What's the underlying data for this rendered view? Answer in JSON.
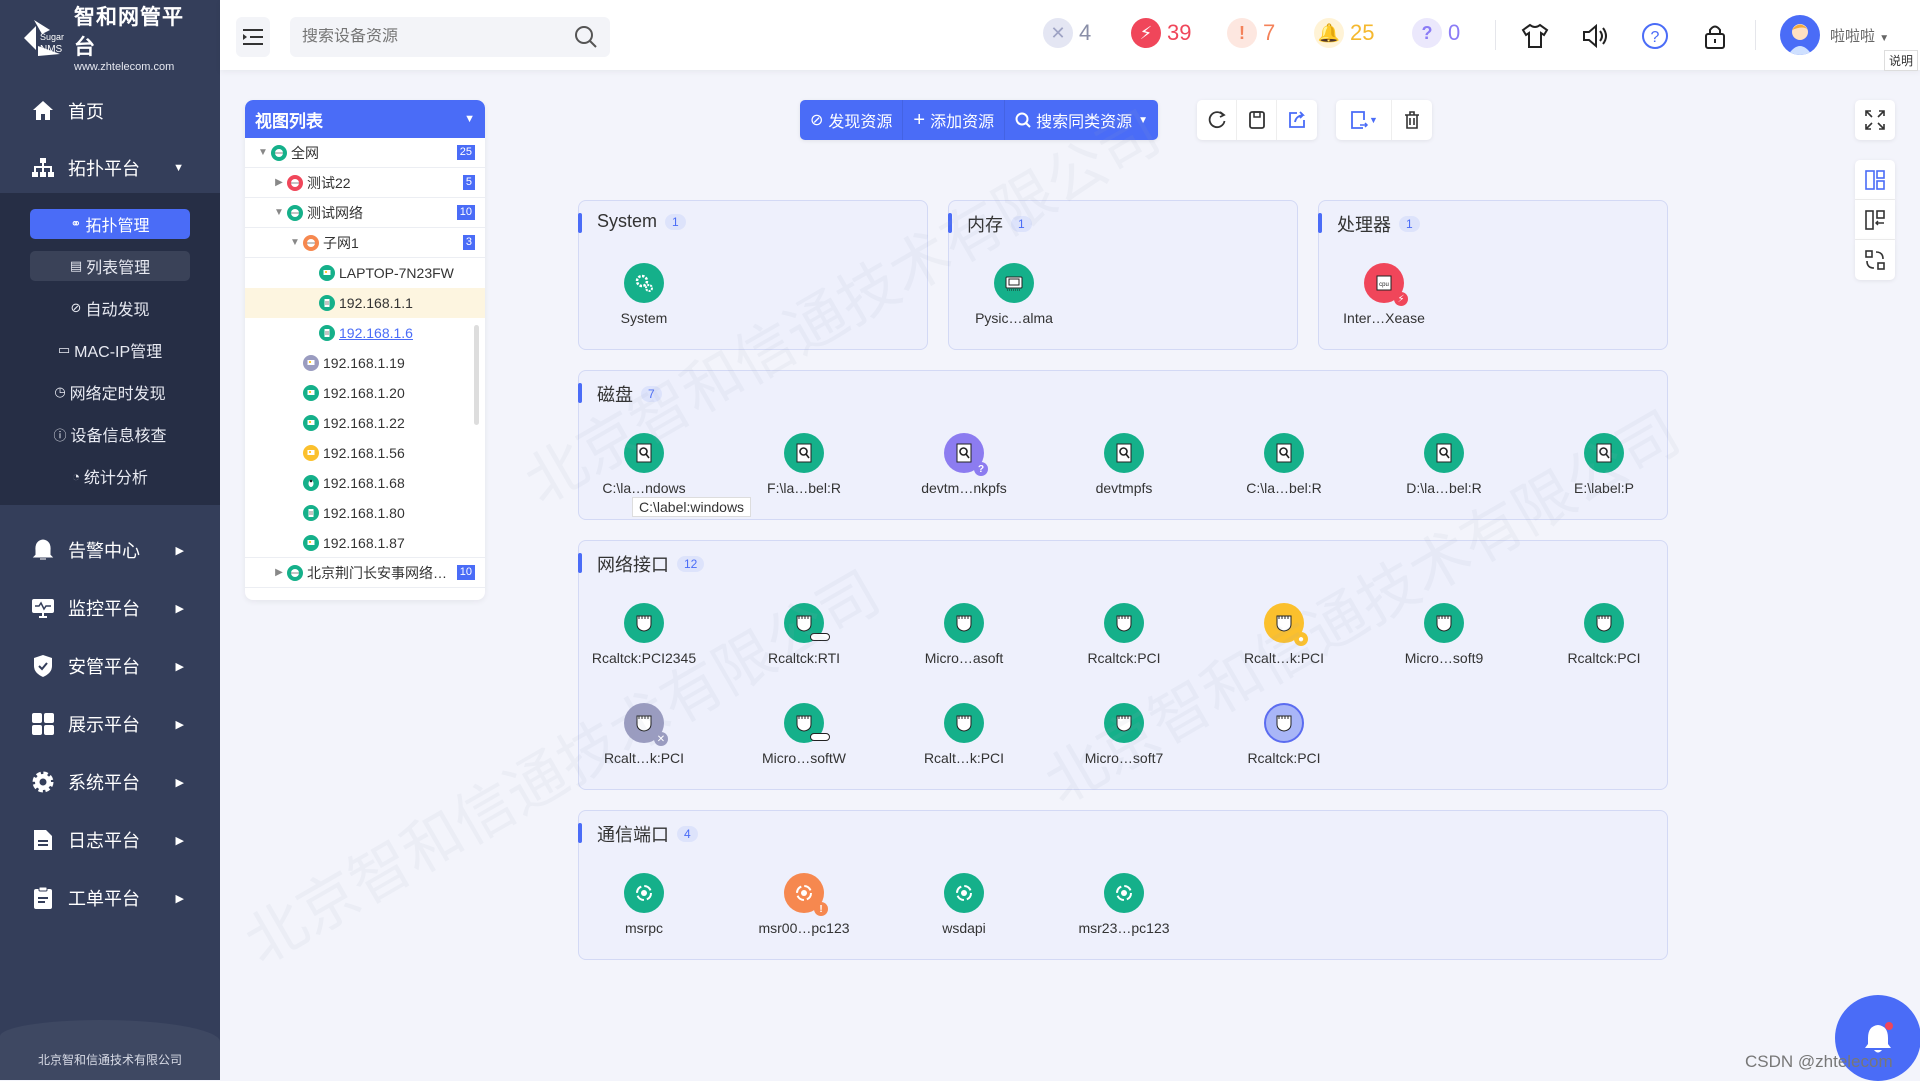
{
  "brand": {
    "title": "智和网管平台",
    "sub": "www.zhtelecom.com",
    "mark": "Sugar NMS"
  },
  "sidebar": {
    "items": [
      {
        "label": "首页",
        "icon": "home-icon"
      },
      {
        "label": "拓扑平台",
        "icon": "topology-icon",
        "expanded": true
      },
      {
        "label": "告警中心",
        "icon": "bell-icon"
      },
      {
        "label": "监控平台",
        "icon": "monitor-icon"
      },
      {
        "label": "安管平台",
        "icon": "shield-icon"
      },
      {
        "label": "展示平台",
        "icon": "grid-icon"
      },
      {
        "label": "系统平台",
        "icon": "gear-icon"
      },
      {
        "label": "日志平台",
        "icon": "log-icon"
      },
      {
        "label": "工单平台",
        "icon": "clipboard-icon"
      }
    ],
    "subitems": [
      {
        "label": "拓扑管理",
        "glyph": "⚭",
        "active": true
      },
      {
        "label": "列表管理",
        "glyph": "▤"
      },
      {
        "label": "自动发现",
        "glyph": "⊘"
      },
      {
        "label": "MAC-IP管理",
        "glyph": "▭"
      },
      {
        "label": "网络定时发现",
        "glyph": "◷"
      },
      {
        "label": "设备信息核查",
        "glyph": "ⓘ"
      },
      {
        "label": "统计分析",
        "glyph": "◔"
      }
    ],
    "footer": "北京智和信通技术有限公司"
  },
  "header": {
    "search_placeholder": "搜索设备资源",
    "stats": [
      {
        "name": "unknown",
        "glyph": "✕",
        "count": "4",
        "bg": "#e4e6f3",
        "fg": "#9ea3c4",
        "text": "#8a8fa8"
      },
      {
        "name": "critical",
        "glyph": "⚡",
        "count": "39",
        "bg": "#f0465a",
        "fg": "#ffffff",
        "text": "#f0465a"
      },
      {
        "name": "major",
        "glyph": "!",
        "count": "7",
        "bg": "#fde7e0",
        "fg": "#f4825a",
        "text": "#f4825a"
      },
      {
        "name": "warning",
        "glyph": "🔔",
        "count": "25",
        "bg": "#fff3d6",
        "fg": "#fbb827",
        "text": "#f5b82e"
      },
      {
        "name": "question",
        "glyph": "?",
        "count": "0",
        "bg": "#ebe8fc",
        "fg": "#8b7cf6",
        "text": "#8b7cf6"
      }
    ],
    "help_tooltip": "说明",
    "username": "啦啦啦"
  },
  "tree": {
    "title": "视图列表",
    "rows": [
      {
        "label": "全网",
        "level": 0,
        "arrow": "down",
        "icon": "globe",
        "color": "#15b08a",
        "badge": "25",
        "border": true
      },
      {
        "label": "测试22",
        "level": 1,
        "arrow": "right",
        "icon": "globe",
        "color": "#f0465a",
        "badge": "5",
        "border": true
      },
      {
        "label": "测试网络",
        "level": 1,
        "arrow": "down",
        "icon": "globe",
        "color": "#15b08a",
        "badge": "10",
        "border": true
      },
      {
        "label": "子网1",
        "level": 2,
        "arrow": "down",
        "icon": "globe",
        "color": "#f6884f",
        "badge": "3",
        "border": true
      },
      {
        "label": "LAPTOP-7N23FW",
        "level": 3,
        "icon": "monitor",
        "color": "#15b08a"
      },
      {
        "label": "192.168.1.1",
        "level": 3,
        "icon": "server",
        "color": "#15b08a",
        "highlight": true
      },
      {
        "label": "192.168.1.6",
        "level": 3,
        "icon": "server",
        "color": "#15b08a",
        "link": true
      },
      {
        "label": "192.168.1.19",
        "level": 2,
        "icon": "monitor",
        "color": "#9a9cc0"
      },
      {
        "label": "192.168.1.20",
        "level": 2,
        "icon": "monitor",
        "color": "#15b08a"
      },
      {
        "label": "192.168.1.22",
        "level": 2,
        "icon": "monitor",
        "color": "#15b08a"
      },
      {
        "label": "192.168.1.56",
        "level": 2,
        "icon": "monitor",
        "color": "#fbc02d"
      },
      {
        "label": "192.168.1.68",
        "level": 2,
        "icon": "linux",
        "color": "#15b08a"
      },
      {
        "label": "192.168.1.80",
        "level": 2,
        "icon": "server",
        "color": "#15b08a"
      },
      {
        "label": "192.168.1.87",
        "level": 2,
        "icon": "monitor",
        "color": "#15b08a",
        "border": true
      },
      {
        "label": "北京荆门长安事网络…",
        "level": 1,
        "arrow": "right",
        "icon": "globe",
        "color": "#15b08a",
        "badge": "10",
        "border": true
      }
    ]
  },
  "toolbar": {
    "discover": "发现资源",
    "add": "添加资源",
    "search_similar": "搜索同类资源"
  },
  "groups": [
    {
      "title": "System",
      "count": "1",
      "kind": "system",
      "items": [
        {
          "label": "System",
          "status": "ok"
        }
      ]
    },
    {
      "title": "内存",
      "count": "1",
      "kind": "memory",
      "items": [
        {
          "label": "Pysic…alma",
          "status": "ok"
        }
      ]
    },
    {
      "title": "处理器",
      "count": "1",
      "kind": "cpu",
      "items": [
        {
          "label": "Inter…Xease",
          "status": "critical"
        }
      ]
    },
    {
      "title": "磁盘",
      "count": "7",
      "kind": "disk",
      "items": [
        {
          "label": "C:\\la…ndows",
          "status": "ok"
        },
        {
          "label": "F:\\la…bel:R",
          "status": "ok"
        },
        {
          "label": "devtm…nkpfs",
          "status": "question"
        },
        {
          "label": "devtmpfs",
          "status": "ok"
        },
        {
          "label": "C:\\la…bel:R",
          "status": "ok"
        },
        {
          "label": "D:\\la…bel:R",
          "status": "ok"
        },
        {
          "label": "E:\\label:P",
          "status": "ok"
        }
      ]
    },
    {
      "title": "网络接口",
      "count": "12",
      "kind": "nic",
      "items": [
        {
          "label": "Rcaltck:PCI2345",
          "status": "ok"
        },
        {
          "label": "Rcaltck:RTI",
          "status": "maintenance"
        },
        {
          "label": "Micro…asoft",
          "status": "ok"
        },
        {
          "label": "Rcaltck:PCI",
          "status": "ok"
        },
        {
          "label": "Rcalt…k:PCI",
          "status": "warning"
        },
        {
          "label": "Micro…soft9",
          "status": "ok"
        },
        {
          "label": "Rcaltck:PCI",
          "status": "ok"
        },
        {
          "label": "Rcalt…k:PCI",
          "status": "unknown"
        },
        {
          "label": "Micro…softW",
          "status": "maintenance"
        },
        {
          "label": "Rcalt…k:PCI",
          "status": "ok"
        },
        {
          "label": "Micro…soft7",
          "status": "ok"
        },
        {
          "label": "Rcaltck:PCI",
          "status": "unmanaged"
        }
      ]
    },
    {
      "title": "通信端口",
      "count": "4",
      "kind": "port",
      "items": [
        {
          "label": "msrpc",
          "status": "ok"
        },
        {
          "label": "msr00…pc123",
          "status": "major"
        },
        {
          "label": "wsdapi",
          "status": "ok"
        },
        {
          "label": "msr23…pc123",
          "status": "ok"
        }
      ]
    }
  ],
  "status_colors": {
    "ok": "#15b08a",
    "critical": "#f0465a",
    "question": "#8c7cf0",
    "warning": "#fbc02d",
    "unknown": "#9a9cc0",
    "unmanaged": "#a9b6f7",
    "major": "#f6884f",
    "maintenance": "#15b08a"
  },
  "hover_tooltip": "C:\\label:windows",
  "watermark": "北京智和信通技术有限公司",
  "credit": "CSDN @zhtelecom"
}
